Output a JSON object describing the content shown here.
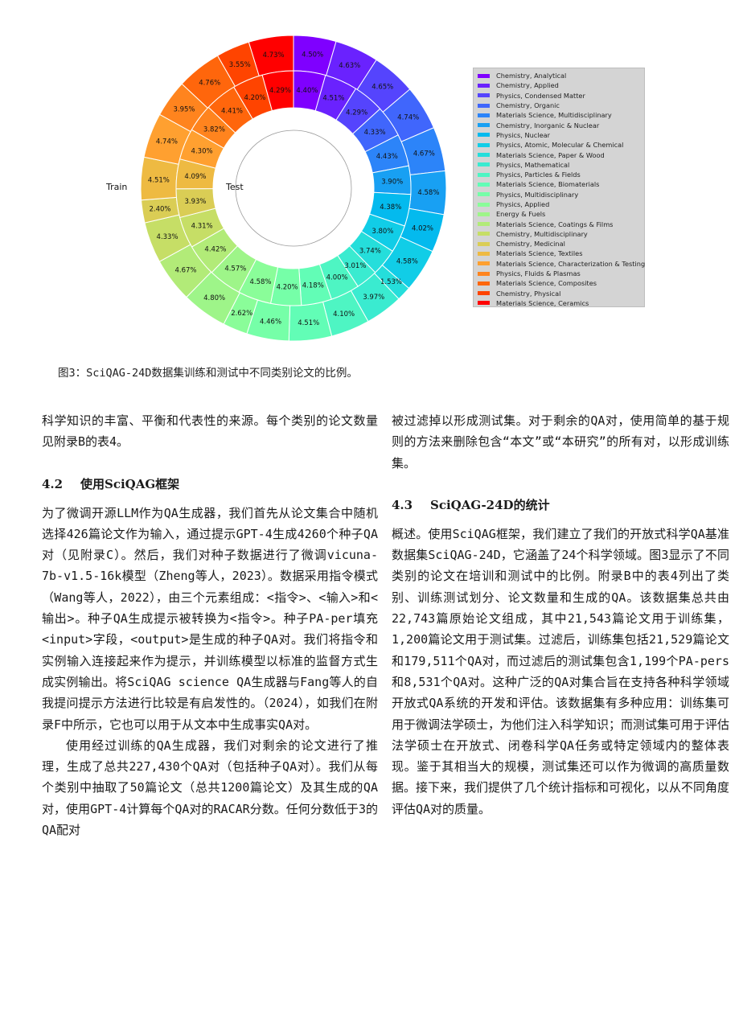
{
  "chart_data": {
    "type": "donut",
    "outer_ring_label": "Train",
    "inner_ring_label": "Test",
    "categories": [
      "Chemistry, Analytical",
      "Chemistry, Applied",
      "Physics, Condensed Matter",
      "Chemistry, Organic",
      "Materials Science, Multidisciplinary",
      "Chemistry, Inorganic & Nuclear",
      "Physics, Nuclear",
      "Physics, Atomic, Molecular & Chemical",
      "Materials Science, Paper & Wood",
      "Physics, Mathematical",
      "Physics, Particles & Fields",
      "Materials Science, Biomaterials",
      "Physics, Multidisciplinary",
      "Physics, Applied",
      "Energy & Fuels",
      "Materials Science, Coatings & Films",
      "Chemistry, Multidisciplinary",
      "Chemistry, Medicinal",
      "Materials Science, Textiles",
      "Materials Science, Characterization & Testing",
      "Physics, Fluids & Plasmas",
      "Materials Science, Composites",
      "Chemistry, Physical",
      "Materials Science, Ceramics"
    ],
    "colors": [
      "#7f00ff",
      "#6a22fe",
      "#5544fd",
      "#4066fc",
      "#2c84f9",
      "#18a0f3",
      "#04baee",
      "#11cde7",
      "#25dedb",
      "#3aebd0",
      "#4ef5c3",
      "#62fdb6",
      "#76ffa8",
      "#8afd99",
      "#9ef589",
      "#b2eb78",
      "#c6de66",
      "#dacd55",
      "#eeba42",
      "#ffa030",
      "#ff841e",
      "#ff660c",
      "#ff4400",
      "#ff0000"
    ],
    "series": [
      {
        "name": "Train",
        "values": [
          4.5,
          4.63,
          4.65,
          4.74,
          4.67,
          4.58,
          4.02,
          4.58,
          1.53,
          3.97,
          4.1,
          4.51,
          4.46,
          2.62,
          4.8,
          4.67,
          4.33,
          2.4,
          4.51,
          4.74,
          3.95,
          4.76,
          3.55,
          4.73
        ]
      },
      {
        "name": "Test",
        "values": [
          4.4,
          4.51,
          4.29,
          4.33,
          4.43,
          3.9,
          4.38,
          3.8,
          3.74,
          3.01,
          4.0,
          4.18,
          4.2,
          4.58,
          4.57,
          4.42,
          4.31,
          3.93,
          4.09,
          4.3,
          3.82,
          4.41,
          4.2,
          4.29
        ]
      }
    ]
  },
  "caption": "图3：SciQAG-24D数据集训练和测试中不同类别论文的比例。",
  "left_column": {
    "p1": "科学知识的丰富、平衡和代表性的来源。每个类别的论文数量见附录B的表4。",
    "h42_num": "4.2",
    "h42_title": "使用SciQAG框架",
    "p2": "为了微调开源LLM作为QA生成器，我们首先从论文集合中随机选择426篇论文作为输入，通过提示GPT-4生成4260个种子QA对（见附录C）。然后，我们对种子数据进行了微调vicuna-7b-v1.5-16k模型（Zheng等人，2023）。数据采用指令模式（Wang等人，2022），由三个元素组成：<指令>、<输入>和<输出>。种子QA生成提示被转换为<指令>。种子PA-per填充<input>字段，<output>是生成的种子QA对。我们将指令和实例输入连接起来作为提示，并训练模型以标准的监督方式生成实例输出。将SciQAG science QA生成器与Fang等人的自我提问提示方法进行比较是有启发性的。（2024），如我们在附录F中所示，它也可以用于从文本中生成事实QA对。",
    "p3": "使用经过训练的QA生成器，我们对剩余的论文进行了推理，生成了总共227,430个QA对（包括种子QA对）。我们从每个类别中抽取了50篇论文（总共1200篇论文）及其生成的QA对，使用GPT-4计算每个QA对的RACAR分数。任何分数低于3的QA配对"
  },
  "right_column": {
    "p1": "被过滤掉以形成测试集。对于剩余的QA对，使用简单的基于规则的方法来删除包含“本文”或“本研究”的所有对，以形成训练集。",
    "h43_num": "4.3",
    "h43_title": "SciQAG-24D的统计",
    "p2": "概述。使用SciQAG框架，我们建立了我们的开放式科学QA基准数据集SciQAG-24D，它涵盖了24个科学领域。图3显示了不同类别的论文在培训和测试中的比例。附录B中的表4列出了类别、训练测试划分、论文数量和生成的QA。该数据集总共由22,743篇原始论文组成，其中21,543篇论文用于训练集，1,200篇论文用于测试集。过滤后，训练集包括21,529篇论文和179,511个QA对，而过滤后的测试集包含1,199个PA-pers和8,531个QA对。这种广泛的QA对集合旨在支持各种科学领域开放式QA系统的开发和评估。该数据集有多种应用：训练集可用于微调法学硕士，为他们注入科学知识；而测试集可用于评估法学硕士在开放式、闭卷科学QA任务或特定领域内的整体表现。鉴于其相当大的规模，测试集还可以作为微调的高质量数据。接下来，我们提供了几个统计指标和可视化，以从不同角度评估QA对的质量。"
  }
}
